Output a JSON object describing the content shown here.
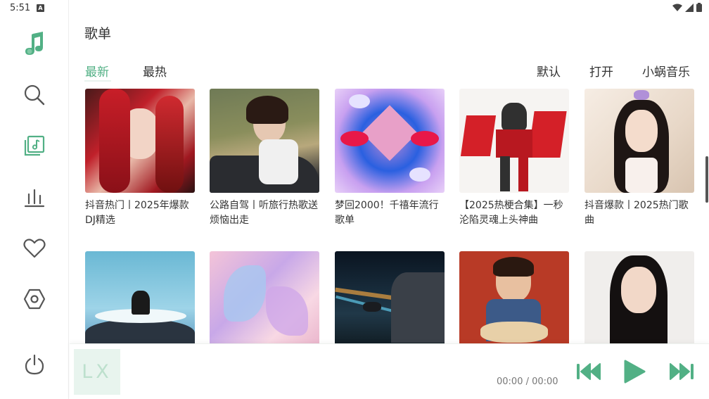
{
  "status": {
    "time": "5:51",
    "a_icon_letter": "A"
  },
  "sidebar": {
    "items": [
      {
        "name": "logo",
        "icon": "music-note-icon"
      },
      {
        "name": "search",
        "icon": "search-icon"
      },
      {
        "name": "songlist",
        "icon": "songlist-icon",
        "active": true
      },
      {
        "name": "leaderboard",
        "icon": "bar-chart-icon"
      },
      {
        "name": "favorites",
        "icon": "heart-icon"
      },
      {
        "name": "settings",
        "icon": "hexagon-settings-icon"
      },
      {
        "name": "power",
        "icon": "power-icon"
      }
    ]
  },
  "page": {
    "title": "歌单"
  },
  "tabs": [
    {
      "label": "最新",
      "active": true
    },
    {
      "label": "最热",
      "active": false
    }
  ],
  "actions": {
    "sort": "默认",
    "open": "打开",
    "source": "小蜗音乐"
  },
  "playlists": [
    {
      "title": "抖音热门丨2025年爆款DJ精选"
    },
    {
      "title": "公路自驾丨听旅行热歌送烦恼出走"
    },
    {
      "title": "梦回2000！千禧年流行歌单"
    },
    {
      "title": "【2025热梗合集】一秒沦陷灵魂上头神曲"
    },
    {
      "title": "抖音爆款丨2025热门歌曲"
    },
    {
      "title": ""
    },
    {
      "title": ""
    },
    {
      "title": ""
    },
    {
      "title": ""
    },
    {
      "title": ""
    }
  ],
  "player": {
    "logo_text": "LX",
    "time": "00:00 / 00:00"
  },
  "colors": {
    "accent": "#52b085",
    "accent_light": "#e8f4ee"
  }
}
